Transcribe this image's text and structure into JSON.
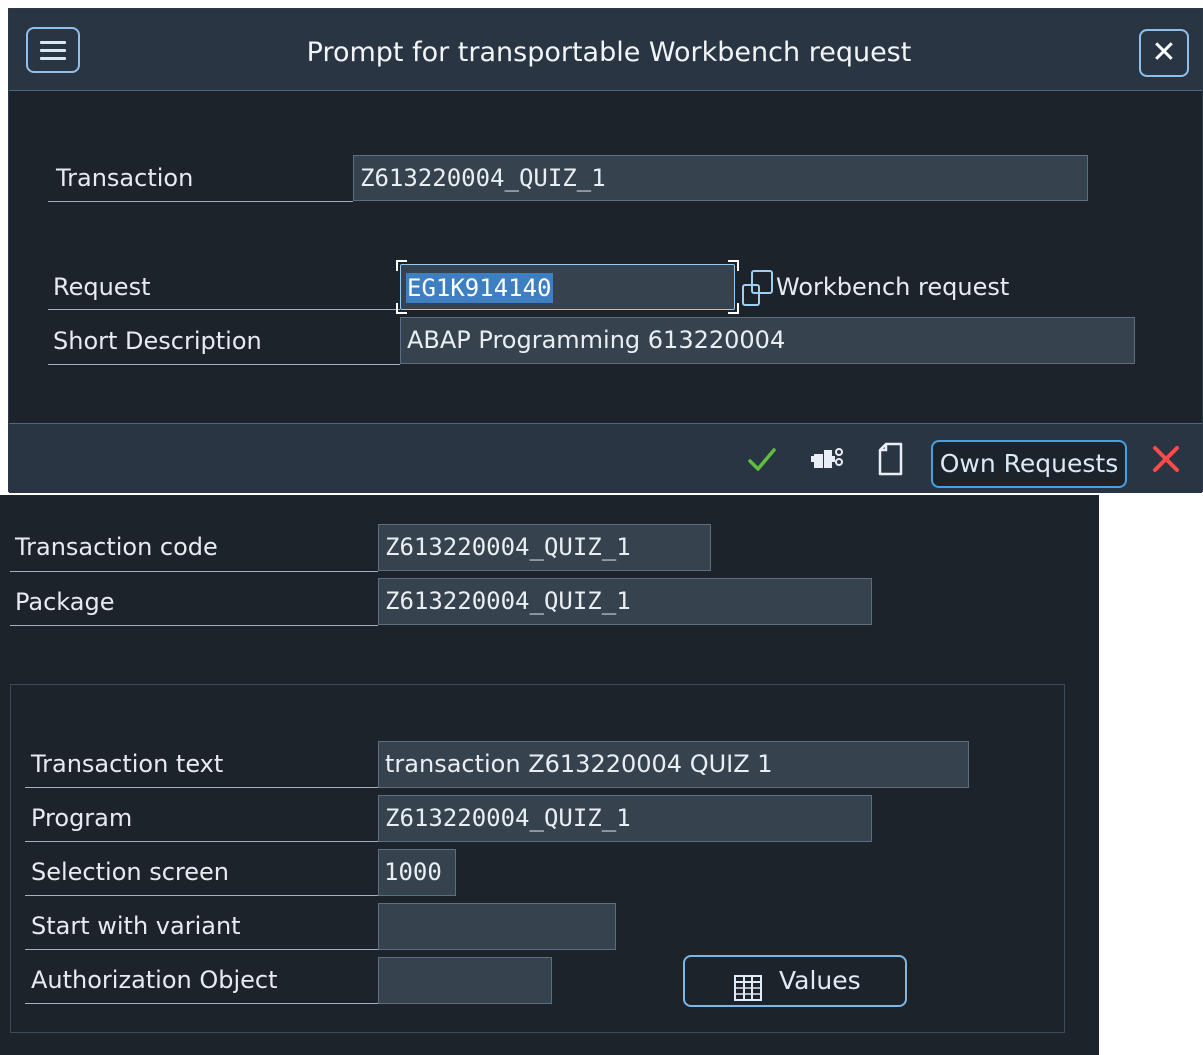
{
  "dialog": {
    "title": "Prompt for transportable Workbench request",
    "menu_icon": "hamburger-menu-icon",
    "close_icon": "close-icon",
    "fields": {
      "transaction": {
        "label": "Transaction",
        "value": "Z613220004_QUIZ_1"
      },
      "request": {
        "label": "Request",
        "value": "EG1K914140",
        "type_text": "Workbench request"
      },
      "short_description": {
        "label": "Short Description",
        "value": "ABAP Programming 613220004"
      }
    },
    "footer": {
      "confirm_icon": "checkmark-icon",
      "create_icon": "create-request-icon",
      "new_icon": "blank-document-icon",
      "own_requests_label": "Own Requests",
      "cancel_icon": "cancel-x-icon"
    }
  },
  "screen": {
    "transaction_code": {
      "label": "Transaction code",
      "value": "Z613220004_QUIZ_1"
    },
    "package": {
      "label": "Package",
      "value": "Z613220004_QUIZ_1"
    },
    "transaction_text": {
      "label": "Transaction text",
      "value": "transaction Z613220004 QUIZ 1"
    },
    "program": {
      "label": "Program",
      "value": "Z613220004_QUIZ_1"
    },
    "selection_screen": {
      "label": "Selection screen",
      "value": "1000"
    },
    "start_with_variant": {
      "label": "Start with variant",
      "value": ""
    },
    "authorization_object": {
      "label": "Authorization Object",
      "value": ""
    },
    "values_button": {
      "label": "Values",
      "icon": "values-table-icon"
    }
  },
  "colors": {
    "background": "#1d232a",
    "header": "#2a3543",
    "field": "#37424f",
    "accent": "#4a9fe0",
    "selection": "#3e7fc1",
    "confirm_green": "#5fbf3c",
    "cancel_red": "#ff4a4a"
  }
}
